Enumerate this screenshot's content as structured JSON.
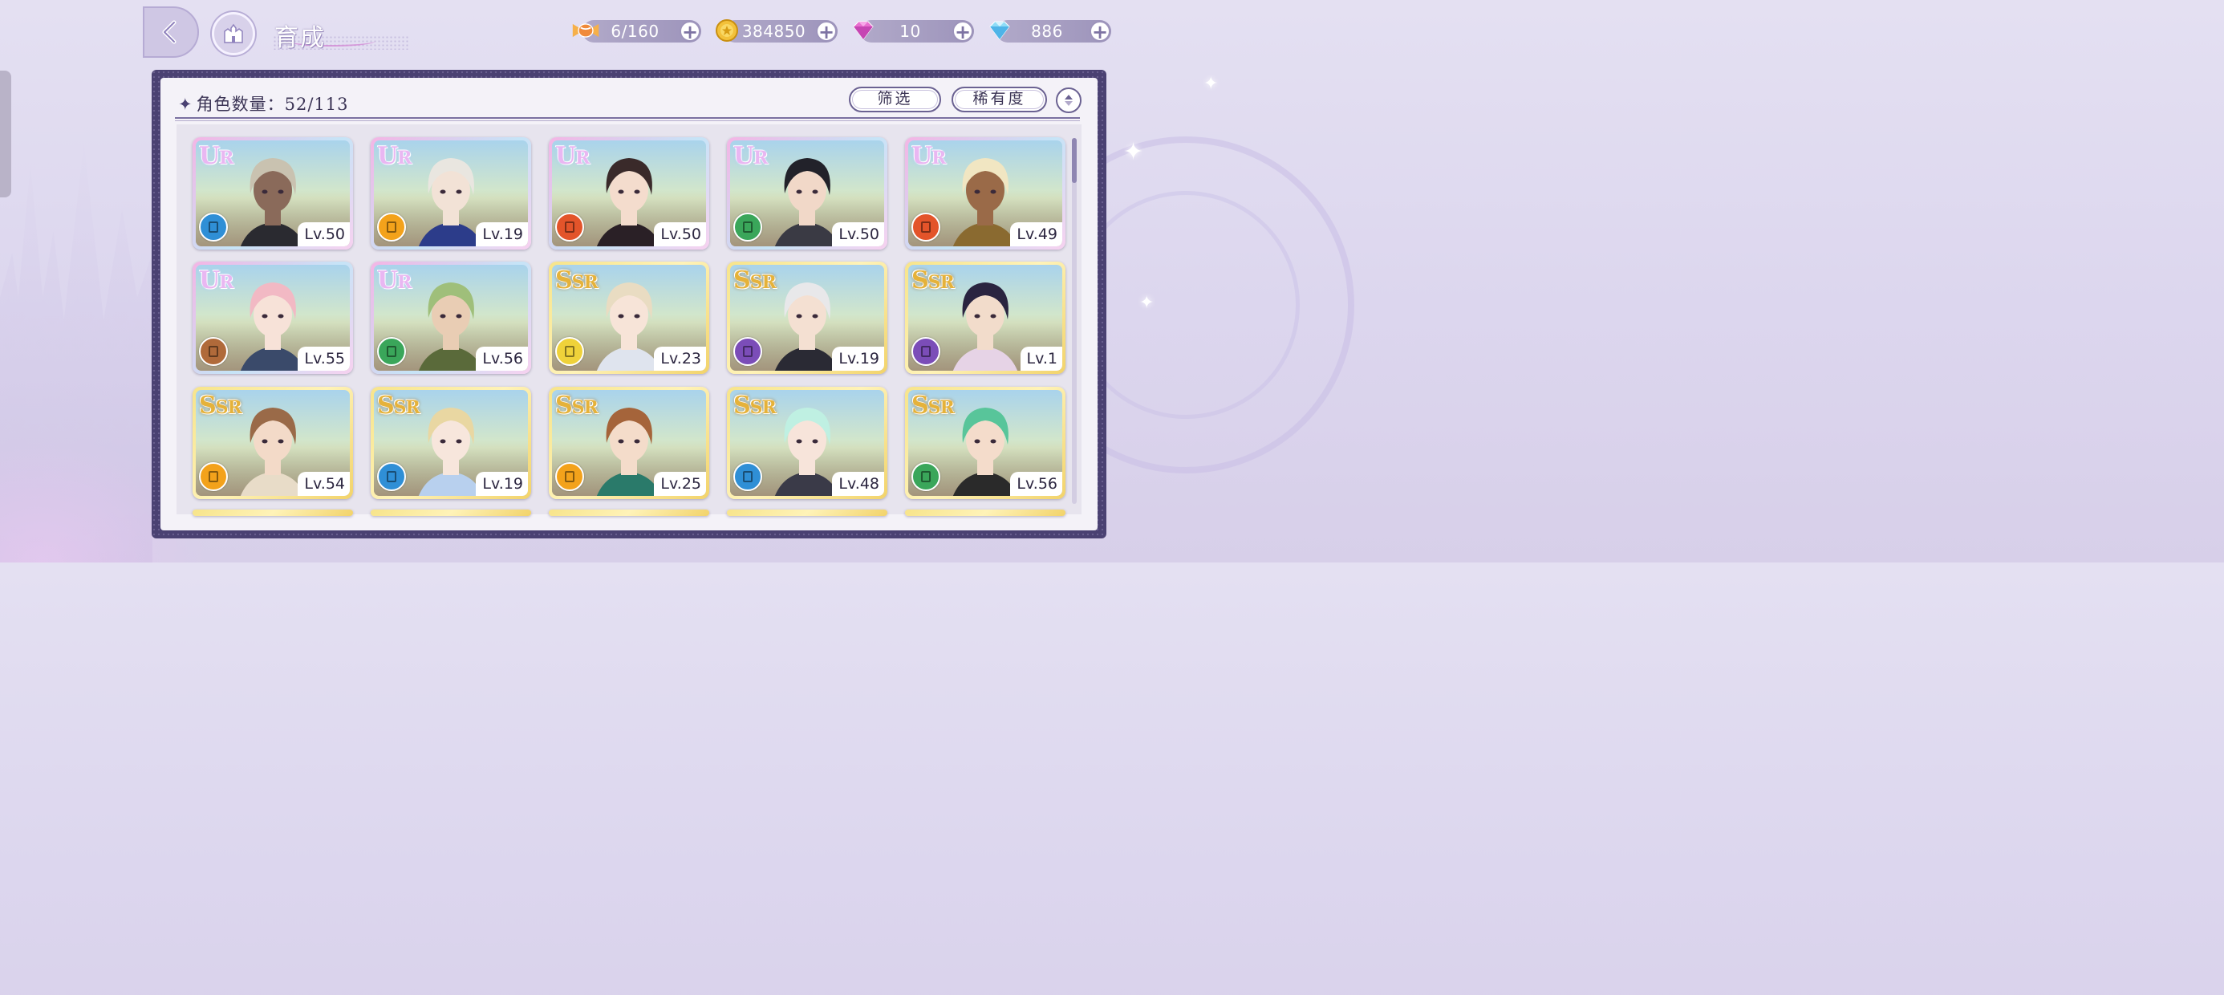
{
  "header": {
    "title": "育成"
  },
  "resources": [
    {
      "name": "stamina",
      "icon": "candy-icon",
      "value": "6/160",
      "color": "#f08a3a"
    },
    {
      "name": "coins",
      "icon": "coin-icon",
      "value": "384850",
      "color": "#f3c13a"
    },
    {
      "name": "pink-gems",
      "icon": "pink-diamond-icon",
      "value": "10",
      "color": "#e96fd0"
    },
    {
      "name": "blue-gems",
      "icon": "blue-diamond-icon",
      "value": "886",
      "color": "#6ec9f2"
    }
  ],
  "panel": {
    "count_label": "角色数量：52/113",
    "filter_button": "筛选",
    "sort_button": "稀有度"
  },
  "cards": [
    {
      "rarity": "UR",
      "level": "Lv.50",
      "type_color": "#2f8fd6"
    },
    {
      "rarity": "UR",
      "level": "Lv.19",
      "type_color": "#f3a21b"
    },
    {
      "rarity": "UR",
      "level": "Lv.50",
      "type_color": "#e3542a"
    },
    {
      "rarity": "UR",
      "level": "Lv.50",
      "type_color": "#3aa65a"
    },
    {
      "rarity": "UR",
      "level": "Lv.49",
      "type_color": "#e3542a"
    },
    {
      "rarity": "UR",
      "level": "Lv.55",
      "type_color": "#b06a3a"
    },
    {
      "rarity": "UR",
      "level": "Lv.56",
      "type_color": "#3aa65a"
    },
    {
      "rarity": "SSR",
      "level": "Lv.23",
      "type_color": "#efd23a"
    },
    {
      "rarity": "SSR",
      "level": "Lv.19",
      "type_color": "#7b4db8"
    },
    {
      "rarity": "SSR",
      "level": "Lv.1",
      "type_color": "#7b4db8"
    },
    {
      "rarity": "SSR",
      "level": "Lv.54",
      "type_color": "#f3a21b"
    },
    {
      "rarity": "SSR",
      "level": "Lv.19",
      "type_color": "#2f8fd6"
    },
    {
      "rarity": "SSR",
      "level": "Lv.25",
      "type_color": "#f3a21b"
    },
    {
      "rarity": "SSR",
      "level": "Lv.48",
      "type_color": "#2f8fd6"
    },
    {
      "rarity": "SSR",
      "level": "Lv.56",
      "type_color": "#3aa65a"
    }
  ]
}
